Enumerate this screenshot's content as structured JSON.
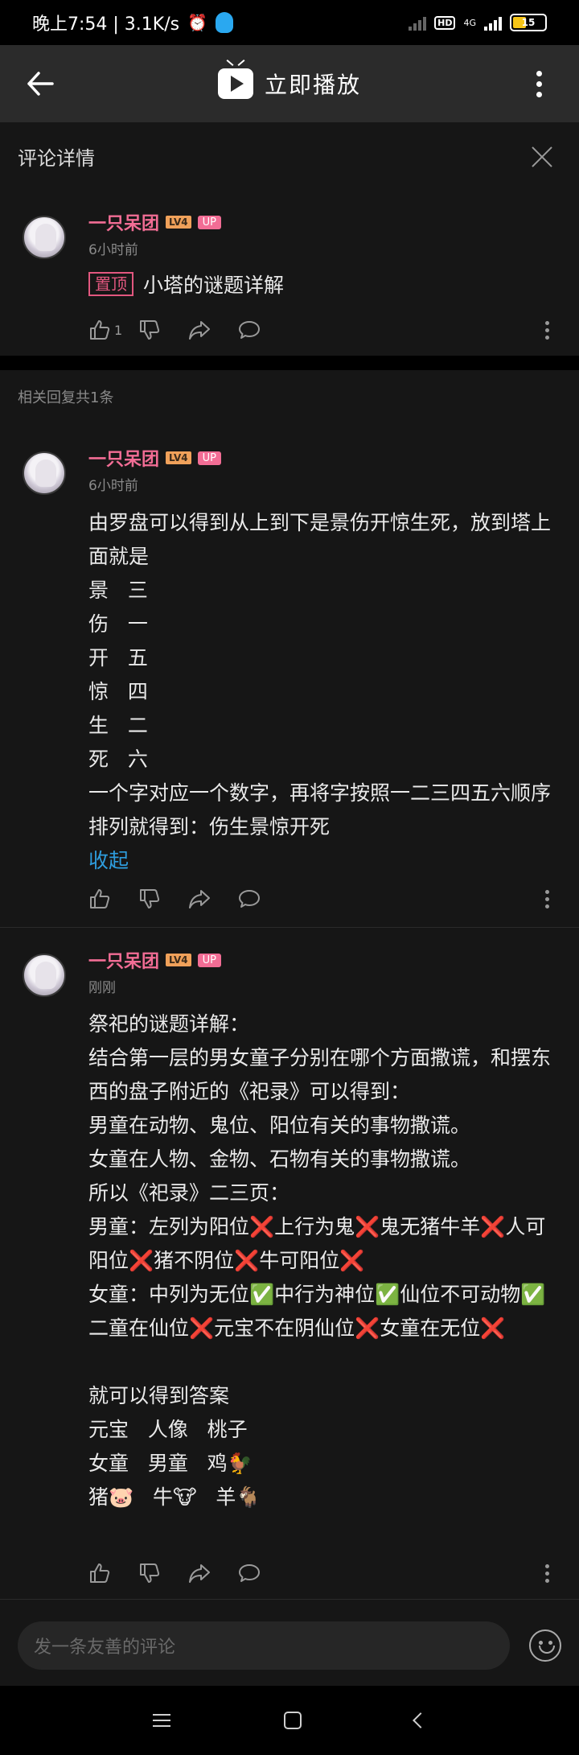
{
  "status_bar": {
    "time_and_speed": "晚上7:54 | 3.1K/s",
    "network": "4G",
    "battery": "15"
  },
  "header": {
    "title": "立即播放"
  },
  "panel": {
    "title": "评论详情"
  },
  "pinned_comment": {
    "username": "一只呆团",
    "level": "LV4",
    "up_badge": "UP",
    "time": "6小时前",
    "pin_label": "置顶",
    "text": "小塔的谜题详解",
    "like_count": "1"
  },
  "replies_label": "相关回复共1条",
  "reply_1": {
    "username": "一只呆团",
    "level": "LV4",
    "up_badge": "UP",
    "time": "6小时前",
    "text": "由罗盘可以得到从上到下是景伤开惊生死，放到塔上面就是\n景   三\n伤   一\n开   五\n惊   四\n生   二\n死   六\n一个字对应一个数字，再将字按照一二三四五六顺序排列就得到：伤生景惊开死",
    "collapse_label": "收起"
  },
  "reply_2": {
    "username": "一只呆团",
    "level": "LV4",
    "up_badge": "UP",
    "time": "刚刚",
    "text": "祭祀的谜题详解：\n结合第一层的男女童子分别在哪个方面撒谎，和摆东西的盘子附近的《祀录》可以得到：\n男童在动物、鬼位、阳位有关的事物撒谎。\n女童在人物、金物、石物有关的事物撒谎。\n所以《祀录》二三页：\n男童：左列为阳位❌上行为鬼❌鬼无猪牛羊❌人可阳位❌猪不阴位❌牛可阳位❌\n女童：中列为无位✅中行为神位✅仙位不可动物✅二童在仙位❌元宝不在阴仙位❌女童在无位❌\n\n就可以得到答案\n元宝   人像   桃子\n女童   男童   鸡🐓\n猪🐷   牛🐮   羊🐐"
  },
  "input": {
    "placeholder": "发一条友善的评论"
  }
}
